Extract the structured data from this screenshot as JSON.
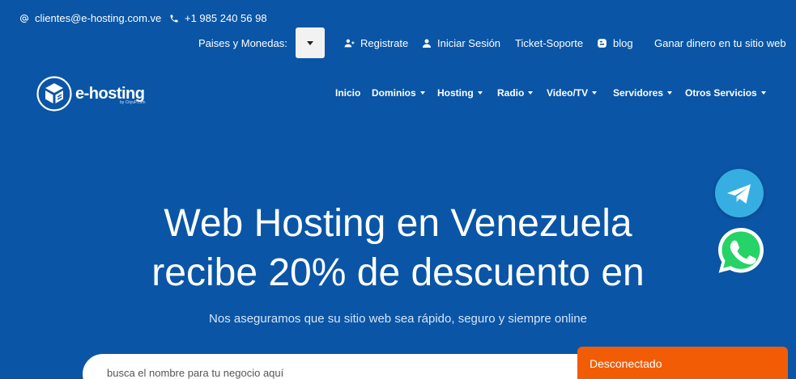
{
  "contact": {
    "email": "clientes@e-hosting.com.ve",
    "phone": "+1 985 240 56 98"
  },
  "utility": {
    "currency_label": "Paises y Monedas:",
    "registrate": "Registrate",
    "login": "Iniciar Sesión",
    "ticket": "Ticket-Soporte",
    "blog": "blog",
    "ganar": "Ganar dinero en tu sitio web"
  },
  "logo": {
    "text": "e-hosting",
    "sub": "by CityuP.com"
  },
  "nav": {
    "items": [
      "Inicio",
      "Dominios",
      "Hosting",
      "Radio",
      "Video/TV",
      "Servidores",
      "Otros Servicios"
    ]
  },
  "hero": {
    "title_line1": "Web Hosting en Venezuela",
    "title_line2": "recibe 20% de descuento en",
    "subtitle": "Nos aseguramos que su sitio web sea rápido, seguro y siempre online"
  },
  "search": {
    "placeholder": "busca el nombre para tu negocio aquí"
  },
  "chat": {
    "status": "Desconectado"
  },
  "colors": {
    "background": "#0a55a6",
    "chat_orange": "#f25c05",
    "telegram": "#37aee2",
    "whatsapp": "#25d366"
  },
  "icons": [
    "at-icon",
    "phone-icon",
    "caret-down-icon",
    "user-plus-icon",
    "user-icon",
    "blogger-icon",
    "telegram-icon",
    "whatsapp-icon",
    "logo-icon"
  ]
}
